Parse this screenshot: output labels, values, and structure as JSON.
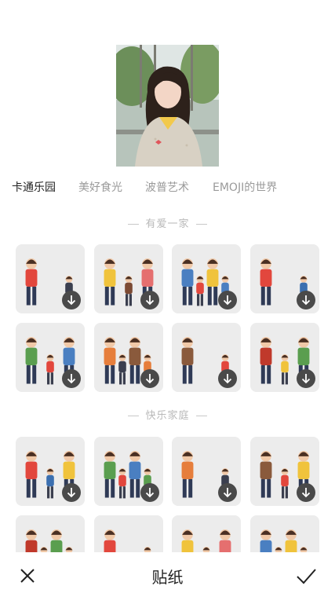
{
  "tabs": [
    {
      "label": "卡通乐园",
      "active": true
    },
    {
      "label": "美好食光",
      "active": false
    },
    {
      "label": "波普艺术",
      "active": false
    },
    {
      "label": "EMOJI的世界",
      "active": false
    }
  ],
  "sections": [
    {
      "title": "有爱一家",
      "sticker_count": 8
    },
    {
      "title": "快乐家庭",
      "sticker_count": 8
    }
  ],
  "download_icon": "download-arrow-icon",
  "bottom_bar": {
    "title": "贴纸",
    "close_icon": "close-icon",
    "confirm_icon": "checkmark-icon"
  },
  "colors": {
    "tile_background": "#ececec",
    "download_badge": "#4a4a4a",
    "tab_active": "#222222",
    "tab_inactive": "#9a9a9a",
    "section_header": "#b9b9b9"
  }
}
